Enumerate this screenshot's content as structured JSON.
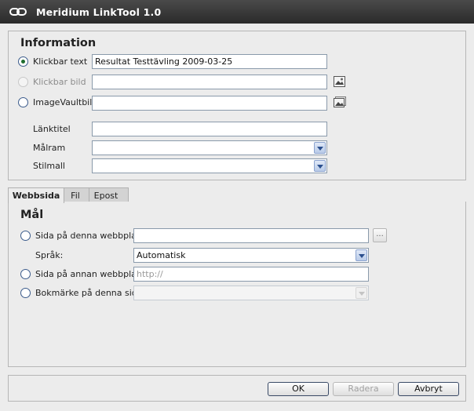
{
  "window": {
    "title": "Meridium LinkTool 1.0"
  },
  "info": {
    "heading": "Information",
    "options": {
      "text_label": "Klickbar text",
      "text_value": "Resultat Testtävling 2009-03-25",
      "image_label": "Klickbar bild",
      "vault_label": "ImageVaultbild"
    },
    "link_title_label": "Länktitel",
    "target_label": "Målram",
    "style_label": "Stilmall"
  },
  "tabs": [
    "Webbsida",
    "Fil",
    "Epost"
  ],
  "target": {
    "heading": "Mål",
    "this_site_label": "Sida på denna webbplats",
    "browse_label": "...",
    "language_label": "Språk:",
    "language_value": "Automatisk",
    "other_site_label": "Sida på annan webbplats",
    "other_site_placeholder": "http://",
    "bookmark_label": "Bokmärke på denna sida"
  },
  "buttons": {
    "ok": "OK",
    "delete": "Radera",
    "cancel": "Avbryt"
  }
}
